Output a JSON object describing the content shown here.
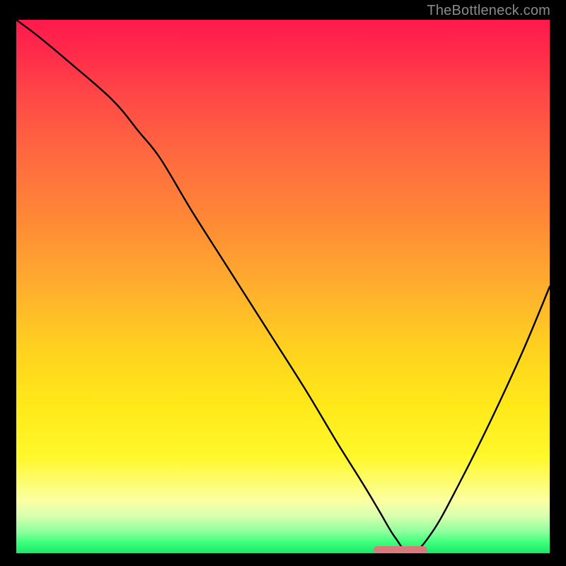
{
  "watermark": "TheBottleneck.com",
  "chart_data": {
    "type": "line",
    "title": "",
    "xlabel": "",
    "ylabel": "",
    "xlim": [
      0,
      100
    ],
    "ylim": [
      0,
      100
    ],
    "grid": false,
    "legend": false,
    "background_gradient": {
      "top": "#ff1a4d",
      "middle": "#ffd21f",
      "bottom": "#17e86b"
    },
    "series": [
      {
        "name": "bottleneck-curve",
        "color": "#000000",
        "x": [
          0,
          4,
          10,
          18,
          23,
          27,
          33,
          40,
          47,
          54,
          60,
          65,
          68,
          71,
          74,
          78,
          83,
          89,
          95,
          100
        ],
        "values": [
          100,
          97,
          92,
          85,
          79,
          74,
          64,
          53,
          42,
          31,
          21,
          13,
          8,
          3,
          0,
          4,
          13,
          25,
          38,
          50
        ]
      }
    ],
    "marker": {
      "name": "optimal-band",
      "x_start": 67,
      "x_end": 77,
      "y": 0.5,
      "color": "#d97a7d"
    }
  }
}
